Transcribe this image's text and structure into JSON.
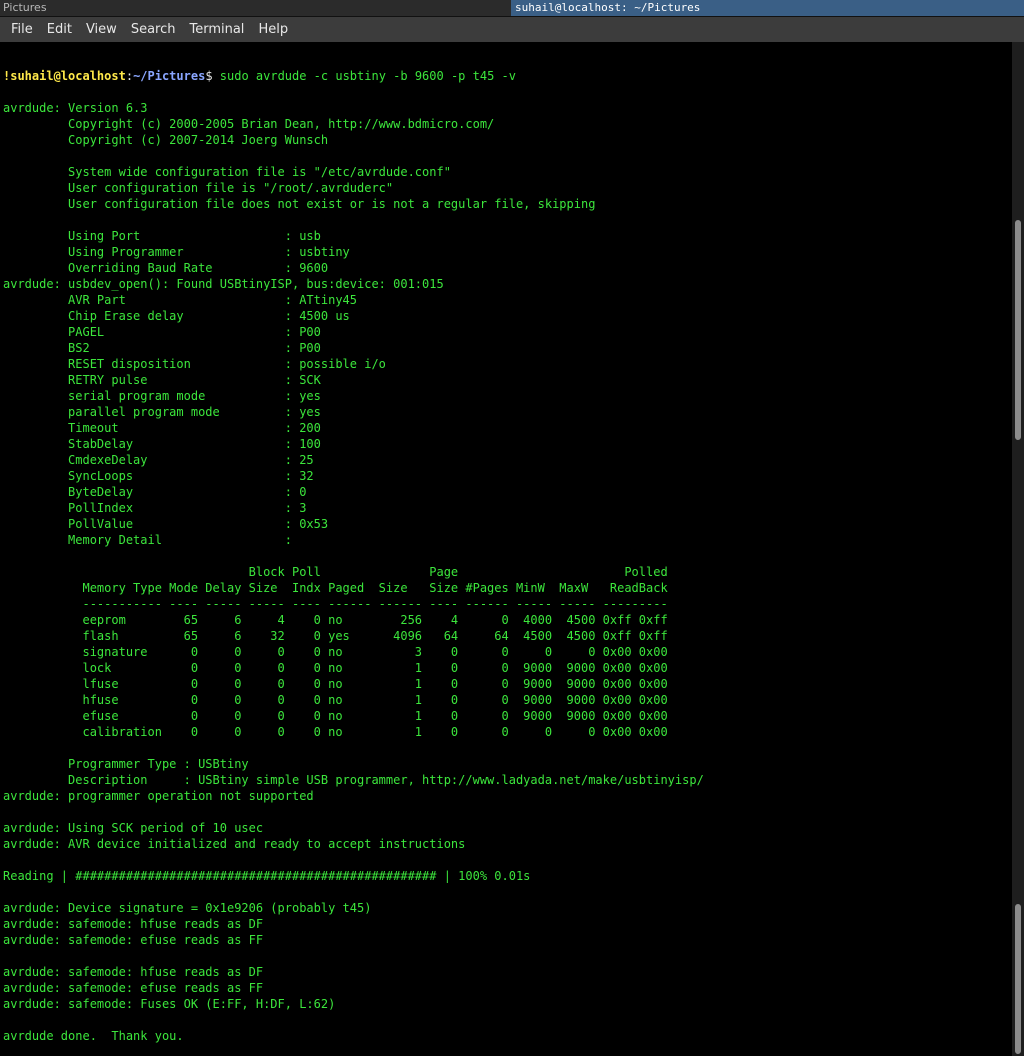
{
  "window": {
    "left_tab": "Pictures",
    "right_tab": "suhail@localhost: ~/Pictures"
  },
  "menu": {
    "items": [
      "File",
      "Edit",
      "View",
      "Search",
      "Terminal",
      "Help"
    ]
  },
  "terminal": {
    "prompt": {
      "user_host": "!suhail@localhost",
      "separator": ":",
      "path": "~/Pictures",
      "symbol": "$ ",
      "command": "sudo avrdude -c usbtiny -b 9600 -p t45 -v"
    },
    "output": [
      "",
      "avrdude: Version 6.3",
      "         Copyright (c) 2000-2005 Brian Dean, http://www.bdmicro.com/",
      "         Copyright (c) 2007-2014 Joerg Wunsch",
      "",
      "         System wide configuration file is \"/etc/avrdude.conf\"",
      "         User configuration file is \"/root/.avrduderc\"",
      "         User configuration file does not exist or is not a regular file, skipping",
      "",
      "         Using Port                    : usb",
      "         Using Programmer              : usbtiny",
      "         Overriding Baud Rate          : 9600",
      "avrdude: usbdev_open(): Found USBtinyISP, bus:device: 001:015",
      "         AVR Part                      : ATtiny45",
      "         Chip Erase delay              : 4500 us",
      "         PAGEL                         : P00",
      "         BS2                           : P00",
      "         RESET disposition             : possible i/o",
      "         RETRY pulse                   : SCK",
      "         serial program mode           : yes",
      "         parallel program mode         : yes",
      "         Timeout                       : 200",
      "         StabDelay                     : 100",
      "         CmdexeDelay                   : 25",
      "         SyncLoops                     : 32",
      "         ByteDelay                     : 0",
      "         PollIndex                     : 3",
      "         PollValue                     : 0x53",
      "         Memory Detail                 :",
      "",
      "                                  Block Poll               Page                       Polled",
      "           Memory Type Mode Delay Size  Indx Paged  Size   Size #Pages MinW  MaxW   ReadBack",
      "           ----------- ---- ----- ----- ---- ------ ------ ---- ------ ----- ----- ---------",
      "           eeprom        65     6     4    0 no        256    4      0  4000  4500 0xff 0xff",
      "           flash         65     6    32    0 yes      4096   64     64  4500  4500 0xff 0xff",
      "           signature      0     0     0    0 no          3    0      0     0     0 0x00 0x00",
      "           lock           0     0     0    0 no          1    0      0  9000  9000 0x00 0x00",
      "           lfuse          0     0     0    0 no          1    0      0  9000  9000 0x00 0x00",
      "           hfuse          0     0     0    0 no          1    0      0  9000  9000 0x00 0x00",
      "           efuse          0     0     0    0 no          1    0      0  9000  9000 0x00 0x00",
      "           calibration    0     0     0    0 no          1    0      0     0     0 0x00 0x00",
      "",
      "         Programmer Type : USBtiny",
      "         Description     : USBtiny simple USB programmer, http://www.ladyada.net/make/usbtinyisp/",
      "avrdude: programmer operation not supported",
      "",
      "avrdude: Using SCK period of 10 usec",
      "avrdude: AVR device initialized and ready to accept instructions",
      "",
      "Reading | ################################################## | 100% 0.01s",
      "",
      "avrdude: Device signature = 0x1e9206 (probably t45)",
      "avrdude: safemode: hfuse reads as DF",
      "avrdude: safemode: efuse reads as FF",
      "",
      "avrdude: safemode: hfuse reads as DF",
      "avrdude: safemode: efuse reads as FF",
      "avrdude: safemode: Fuses OK (E:FF, H:DF, L:62)",
      "",
      "avrdude done.  Thank you."
    ]
  }
}
